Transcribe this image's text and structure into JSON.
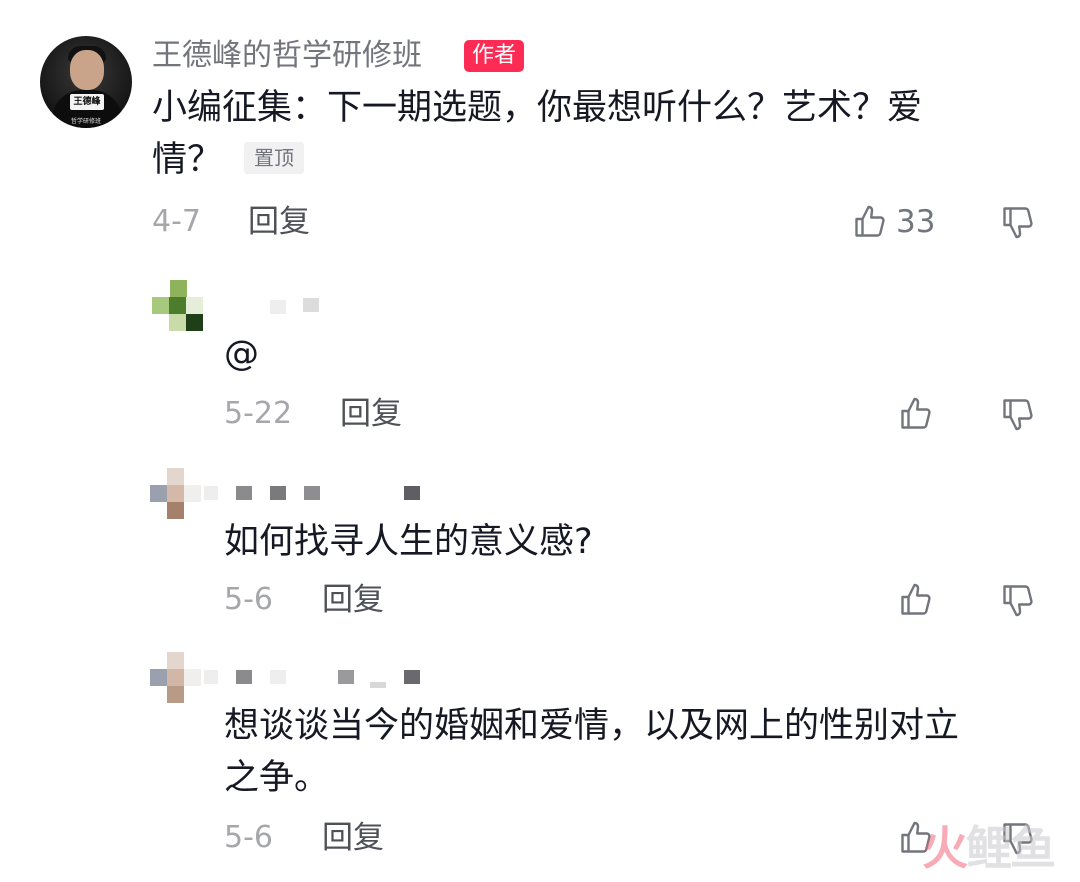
{
  "author_comment": {
    "username": "王德峰的哲学研修班",
    "author_tag": "作者",
    "avatar_badge": "王德峰",
    "avatar_caption": "哲学研修班",
    "text_line1": "小编征集：下一期选题，你最想听什么？艺术？爱",
    "text_line2": "情？",
    "pin_tag": "置顶",
    "date": "4-7",
    "reply_label": "回复",
    "like_count": "33"
  },
  "replies": [
    {
      "text": "@",
      "date": "5-22",
      "reply_label": "回复"
    },
    {
      "text": "如何找寻人生的意义感?",
      "date": "5-6",
      "reply_label": "回复"
    },
    {
      "text_line1": "想谈谈当今的婚姻和爱情，以及网上的性别对立",
      "text_line2": "之争。",
      "date": "5-6",
      "reply_label": "回复"
    }
  ],
  "watermark": {
    "part1": "火",
    "part2": "鲤鱼"
  },
  "icons": {
    "like": "thumbs-up-icon",
    "dislike": "thumbs-down-icon"
  }
}
